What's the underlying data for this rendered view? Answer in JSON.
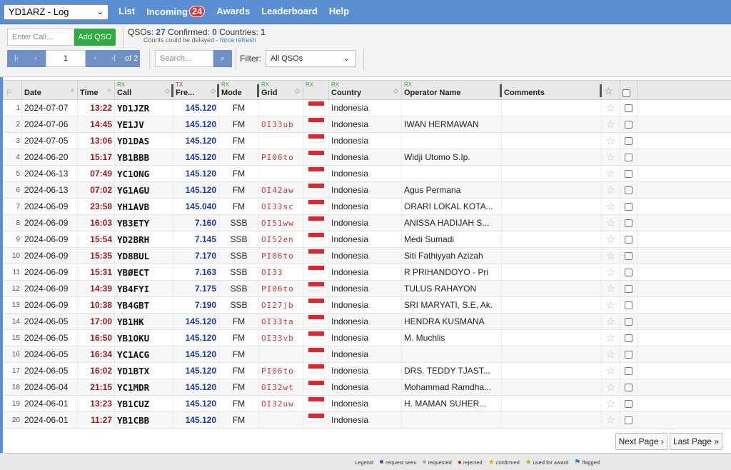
{
  "topnav": {
    "log_select": "YD1ARZ - Log",
    "links": [
      {
        "label": "List"
      },
      {
        "label": "Incoming",
        "badge": "24"
      },
      {
        "label": "Awards"
      },
      {
        "label": "Leaderboard"
      },
      {
        "label": "Help"
      }
    ]
  },
  "toolbar": {
    "call_placeholder": "Enter Call...",
    "add_qso_label": "Add QSO",
    "qsos_label": "QSOs:",
    "qsos_value": "27",
    "confirmed_label": "Confirmed:",
    "confirmed_value": "0",
    "countries_label": "Countries:",
    "countries_value": "1",
    "delay_note": "Counts could be delayed -",
    "force_refresh": "force refresh",
    "page_value": "1",
    "page_of": "of 2",
    "search_placeholder": "Search...",
    "filter_label": "Filter:",
    "filter_value": "All QSOs"
  },
  "columns": {
    "date": "Date",
    "time": "Time",
    "call": "Call",
    "freq": "Fre...",
    "mode": "Mode",
    "grid": "Grid",
    "country": "Country",
    "operator": "Operator Name",
    "comments": "Comments",
    "rx_tag": "RX",
    "tx_tag": "TX"
  },
  "rows": [
    {
      "n": "1",
      "date": "2024-07-07",
      "time": "13:22",
      "call": "YD1JZR",
      "freq": "145.120",
      "mode": "FM",
      "grid": "",
      "country": "Indonesia",
      "operator": ""
    },
    {
      "n": "2",
      "date": "2024-07-06",
      "time": "14:45",
      "call": "YE1JV",
      "freq": "145.120",
      "mode": "FM",
      "grid": "OI33ub",
      "country": "Indonesia",
      "operator": "IWAN HERMAWAN"
    },
    {
      "n": "3",
      "date": "2024-07-05",
      "time": "13:06",
      "call": "YD1DAS",
      "freq": "145.120",
      "mode": "FM",
      "grid": "",
      "country": "Indonesia",
      "operator": ""
    },
    {
      "n": "4",
      "date": "2024-06-20",
      "time": "15:17",
      "call": "YB1BBB",
      "freq": "145.120",
      "mode": "FM",
      "grid": "PI06to",
      "country": "Indonesia",
      "operator": "Widji Utomo S.Ip."
    },
    {
      "n": "5",
      "date": "2024-06-13",
      "time": "07:49",
      "call": "YC1ONG",
      "freq": "145.120",
      "mode": "FM",
      "grid": "",
      "country": "Indonesia",
      "operator": ""
    },
    {
      "n": "6",
      "date": "2024-06-13",
      "time": "07:02",
      "call": "YG1AGU",
      "freq": "145.120",
      "mode": "FM",
      "grid": "OI42aw",
      "country": "Indonesia",
      "operator": "Agus Permana"
    },
    {
      "n": "7",
      "date": "2024-06-09",
      "time": "23:58",
      "call": "YH1AVB",
      "freq": "145.040",
      "mode": "FM",
      "grid": "OI33sc",
      "country": "Indonesia",
      "operator": "ORARI LOKAL KOTA..."
    },
    {
      "n": "8",
      "date": "2024-06-09",
      "time": "16:03",
      "call": "YB3ETY",
      "freq": "7.160",
      "mode": "SSB",
      "grid": "OI51ww",
      "country": "Indonesia",
      "operator": "ANISSA HADIJAH S..."
    },
    {
      "n": "9",
      "date": "2024-06-09",
      "time": "15:54",
      "call": "YD2BRH",
      "freq": "7.145",
      "mode": "SSB",
      "grid": "OI52en",
      "country": "Indonesia",
      "operator": "Medi Sumadi"
    },
    {
      "n": "10",
      "date": "2024-06-09",
      "time": "15:35",
      "call": "YD8BUL",
      "freq": "7.170",
      "mode": "SSB",
      "grid": "PI06to",
      "country": "Indonesia",
      "operator": "Siti Fathiyyah Azizah"
    },
    {
      "n": "11",
      "date": "2024-06-09",
      "time": "15:31",
      "call": "YBØECT",
      "freq": "7.163",
      "mode": "SSB",
      "grid": "OI33",
      "country": "Indonesia",
      "operator": "R PRIHANDOYO - Pri"
    },
    {
      "n": "12",
      "date": "2024-06-09",
      "time": "14:39",
      "call": "YB4FYI",
      "freq": "7.175",
      "mode": "SSB",
      "grid": "PI06to",
      "country": "Indonesia",
      "operator": "TULUS RAHAYON"
    },
    {
      "n": "13",
      "date": "2024-06-09",
      "time": "10:38",
      "call": "YB4GBT",
      "freq": "7.190",
      "mode": "SSB",
      "grid": "OI27jb",
      "country": "Indonesia",
      "operator": "SRI MARYATI, S.E, Ak."
    },
    {
      "n": "14",
      "date": "2024-06-05",
      "time": "17:00",
      "call": "YB1HK",
      "freq": "145.120",
      "mode": "FM",
      "grid": "OI33ta",
      "country": "Indonesia",
      "operator": "HENDRA KUSMANA"
    },
    {
      "n": "15",
      "date": "2024-06-05",
      "time": "16:50",
      "call": "YB1OKU",
      "freq": "145.120",
      "mode": "FM",
      "grid": "OI33vb",
      "country": "Indonesia",
      "operator": "M. Muchlis"
    },
    {
      "n": "16",
      "date": "2024-06-05",
      "time": "16:34",
      "call": "YC1ACG",
      "freq": "145.120",
      "mode": "FM",
      "grid": "",
      "country": "Indonesia",
      "operator": ""
    },
    {
      "n": "17",
      "date": "2024-06-05",
      "time": "16:02",
      "call": "YD1BTX",
      "freq": "145.120",
      "mode": "FM",
      "grid": "PI06to",
      "country": "Indonesia",
      "operator": "DRS. TEDDY TJAST..."
    },
    {
      "n": "18",
      "date": "2024-06-04",
      "time": "21:15",
      "call": "YC1MDR",
      "freq": "145.120",
      "mode": "FM",
      "grid": "OI32wt",
      "country": "Indonesia",
      "operator": "Mohammad Ramdha..."
    },
    {
      "n": "19",
      "date": "2024-06-01",
      "time": "13:23",
      "call": "YB1CUZ",
      "freq": "145.120",
      "mode": "FM",
      "grid": "OI32uw",
      "country": "Indonesia",
      "operator": "H. MAMAN SUHER..."
    },
    {
      "n": "20",
      "date": "2024-06-01",
      "time": "11:27",
      "call": "YB1CBB",
      "freq": "145.120",
      "mode": "FM",
      "grid": "",
      "country": "Indonesia",
      "operator": ""
    }
  ],
  "bottom_pager": {
    "next": "Next Page ›",
    "last": "Last Page »"
  },
  "legend": {
    "title": "Legend:",
    "items": [
      "request seen",
      "requested",
      "rejected",
      "confirmed",
      "used for award",
      "flagged"
    ],
    "colors": {
      "request_seen": "#2a5db0",
      "requested": "#aaaaaa",
      "rejected": "#d32020",
      "confirmed": "#e0b000",
      "flagged": "#2a7ad0"
    }
  },
  "colors": {
    "nav": "#5b8fd3",
    "add_button": "#2faa43",
    "time": "#a31818",
    "freq": "#1b3a9e",
    "grid": "#c83636",
    "flag_red": "#e3242b"
  }
}
